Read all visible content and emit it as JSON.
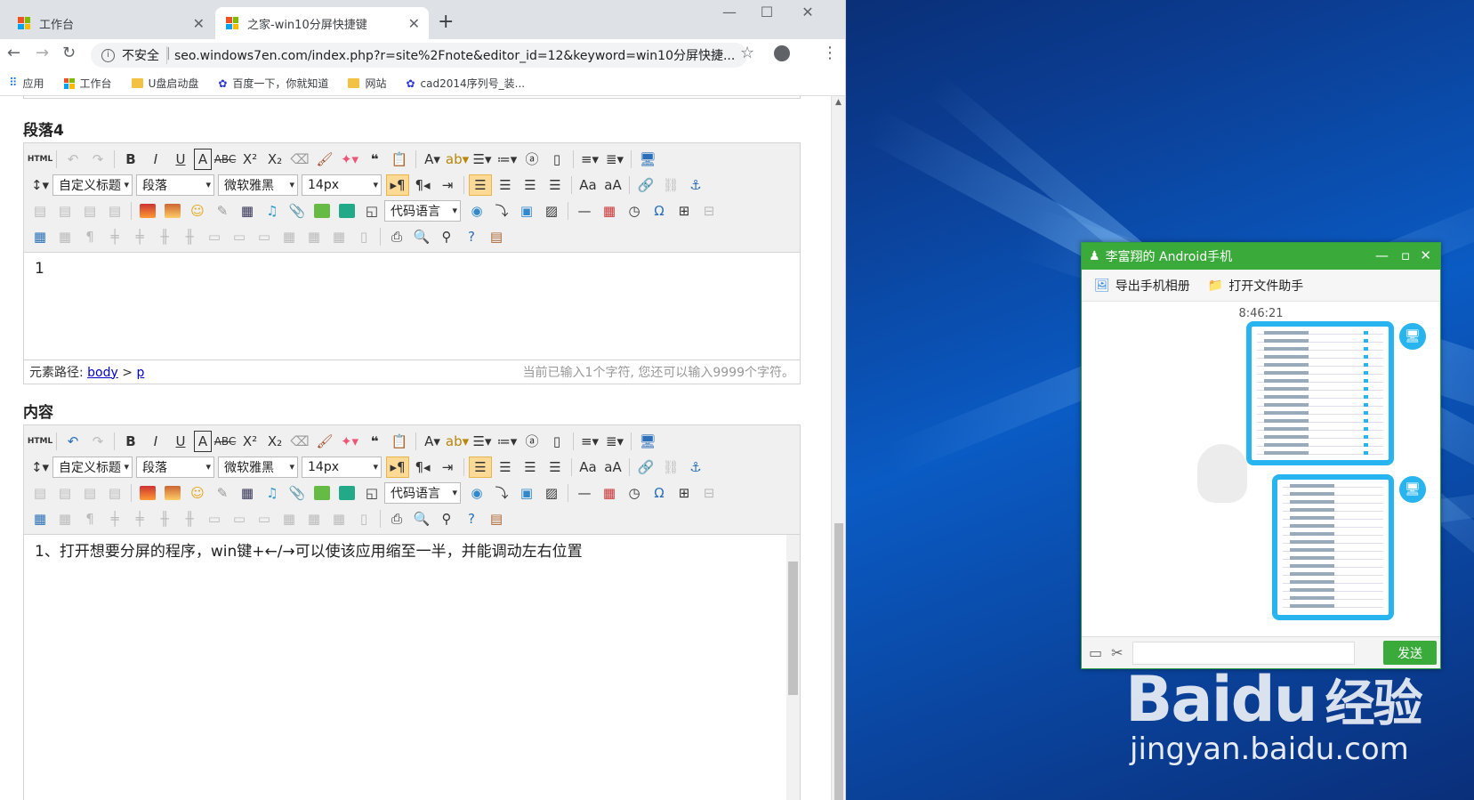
{
  "browser": {
    "tabs": [
      {
        "label": "工作台"
      },
      {
        "label": "之家-win10分屏快捷键"
      }
    ],
    "new_tab": "+",
    "window_controls": {
      "minimize": "—",
      "maximize": "☐",
      "close": "✕"
    },
    "address": {
      "security": "不安全",
      "url": "seo.windows7en.com/index.php?r=site%2Fnote&editor_id=12&keyword=win10分屏快捷..."
    },
    "bookmarks": [
      {
        "label": "应用",
        "icon": "apps-grid-icon"
      },
      {
        "label": "工作台",
        "icon": "windows-logo-icon"
      },
      {
        "label": "U盘启动盘",
        "icon": "folder-icon"
      },
      {
        "label": "百度一下，你就知道",
        "icon": "baidu-paw-icon"
      },
      {
        "label": "网站",
        "icon": "folder-icon"
      },
      {
        "label": "cad2014序列号_装...",
        "icon": "baidu-paw-icon"
      }
    ]
  },
  "editor1": {
    "heading": "段落4",
    "style_select": "自定义标题",
    "para_select": "段落",
    "font_select": "微软雅黑",
    "size_select": "14px",
    "code_select": "代码语言",
    "content": "1",
    "path_label": "元素路径:",
    "path_body": "body",
    "path_gt": ">",
    "path_p": "p",
    "count": "当前已输入1个字符, 您还可以输入9999个字符。"
  },
  "editor2": {
    "heading": "内容",
    "style_select": "自定义标题",
    "para_select": "段落",
    "font_select": "微软雅黑",
    "size_select": "14px",
    "code_select": "代码语言",
    "content": "1、打开想要分屏的程序，win键+←/→可以使该应用缩至一半，并能调动左右位置"
  },
  "qq": {
    "title": "李富翔的 Android手机",
    "tool_export": "导出手机相册",
    "tool_open": "打开文件助手",
    "time": "8:46:21",
    "send": "发送"
  },
  "watermark": {
    "line1": "Baidu",
    "line1_cn": "经验",
    "line2": "jingyan.baidu.com"
  },
  "colors": {
    "qq_green": "#3aab3a",
    "accent_blue": "#27b4ef",
    "link": "#0000cc"
  }
}
